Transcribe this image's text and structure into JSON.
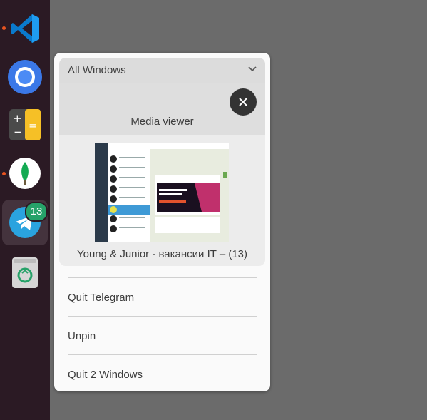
{
  "dock": {
    "items": [
      {
        "name": "Visual Studio Code",
        "icon": "vscode-icon",
        "running": true
      },
      {
        "name": "Chromium",
        "icon": "chromium-icon",
        "running": false
      },
      {
        "name": "Calculator",
        "icon": "calculator-icon",
        "running": false
      },
      {
        "name": "MongoDB Compass",
        "icon": "mongodb-icon",
        "running": true
      },
      {
        "name": "Telegram",
        "icon": "telegram-icon",
        "running": true,
        "active": true,
        "badge": "13"
      },
      {
        "name": "Trash",
        "icon": "trash-icon",
        "running": false
      }
    ],
    "colors": {
      "background": "#2b1a24",
      "running_dot": "#e95420",
      "badge": "#26a269"
    }
  },
  "menu": {
    "group_header": "All Windows",
    "media_title": "Media viewer",
    "window_caption": "Young & Junior - вакансии IT – (13)",
    "items": [
      "Quit Telegram",
      "Unpin",
      "Quit 2 Windows"
    ]
  }
}
